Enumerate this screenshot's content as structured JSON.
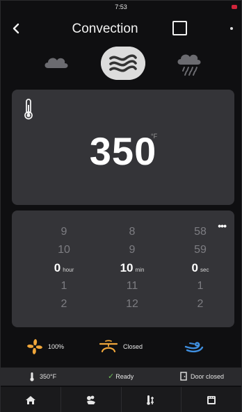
{
  "status_bar": {
    "time": "7:53"
  },
  "header": {
    "title": "Convection"
  },
  "modes": [
    {
      "name": "cloud-mode",
      "icon": "cloud-icon"
    },
    {
      "name": "convection-mode",
      "icon": "waves-icon",
      "selected": true
    },
    {
      "name": "steam-mode",
      "icon": "cloud-rain-icon"
    }
  ],
  "temperature": {
    "value": "350",
    "unit": "°F"
  },
  "timer": {
    "hours": [
      "9",
      "10",
      "0",
      "1",
      "2"
    ],
    "minutes": [
      "8",
      "9",
      "10",
      "11",
      "12"
    ],
    "seconds": [
      "58",
      "59",
      "0",
      "1",
      "2"
    ],
    "hour_unit": "hour",
    "minute_unit": "min",
    "second_unit": "sec"
  },
  "controls": {
    "fan_label": "100%",
    "door_label": "Closed"
  },
  "status_strip": {
    "temp": "350°F",
    "ready": "Ready",
    "door": "Door closed"
  },
  "colors": {
    "accent": "#f0a63a",
    "steam": "#3f8fe0",
    "ready": "#6dbf58",
    "card": "#343438"
  }
}
